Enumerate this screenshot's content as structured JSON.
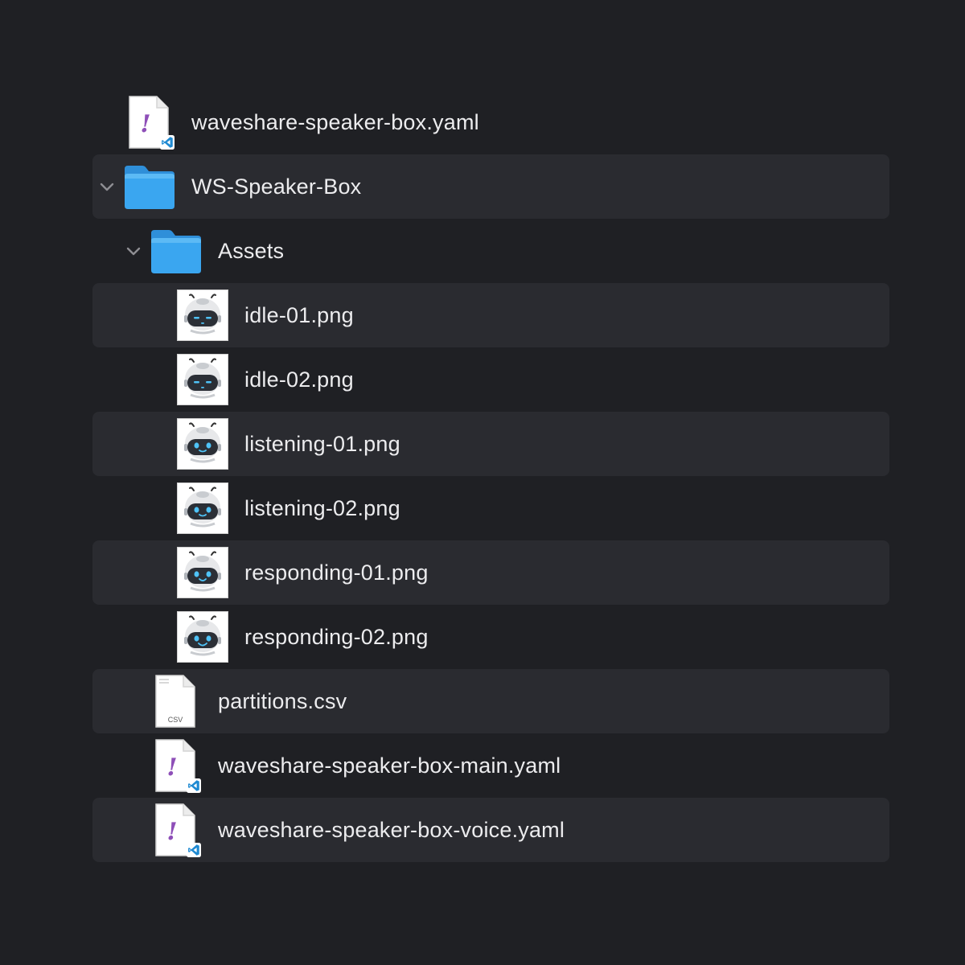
{
  "colors": {
    "background": "#1f2024",
    "row_stripe": "#2a2b30",
    "folder_blue": "#3aa6f0",
    "yaml_purple": "#8e4fb8",
    "vscode_blue": "#1f8ad2"
  },
  "items": [
    {
      "name": "waveshare-speaker-box.yaml",
      "kind": "yaml",
      "icon": "yaml-file-icon"
    },
    {
      "name": "WS-Speaker-Box",
      "kind": "folder",
      "icon": "folder-icon",
      "expanded": true
    },
    {
      "name": "Assets",
      "kind": "folder",
      "icon": "folder-icon",
      "expanded": true
    },
    {
      "name": "idle-01.png",
      "kind": "image",
      "icon": "robot-thumbnail-icon",
      "face": "idle"
    },
    {
      "name": "idle-02.png",
      "kind": "image",
      "icon": "robot-thumbnail-icon",
      "face": "idle"
    },
    {
      "name": "listening-01.png",
      "kind": "image",
      "icon": "robot-thumbnail-icon",
      "face": "listening"
    },
    {
      "name": "listening-02.png",
      "kind": "image",
      "icon": "robot-thumbnail-icon",
      "face": "listening"
    },
    {
      "name": "responding-01.png",
      "kind": "image",
      "icon": "robot-thumbnail-icon",
      "face": "responding"
    },
    {
      "name": "responding-02.png",
      "kind": "image",
      "icon": "robot-thumbnail-icon",
      "face": "responding"
    },
    {
      "name": "partitions.csv",
      "kind": "csv",
      "icon": "csv-file-icon",
      "badge": "CSV"
    },
    {
      "name": "waveshare-speaker-box-main.yaml",
      "kind": "yaml",
      "icon": "yaml-file-icon"
    },
    {
      "name": "waveshare-speaker-box-voice.yaml",
      "kind": "yaml",
      "icon": "yaml-file-icon"
    }
  ]
}
